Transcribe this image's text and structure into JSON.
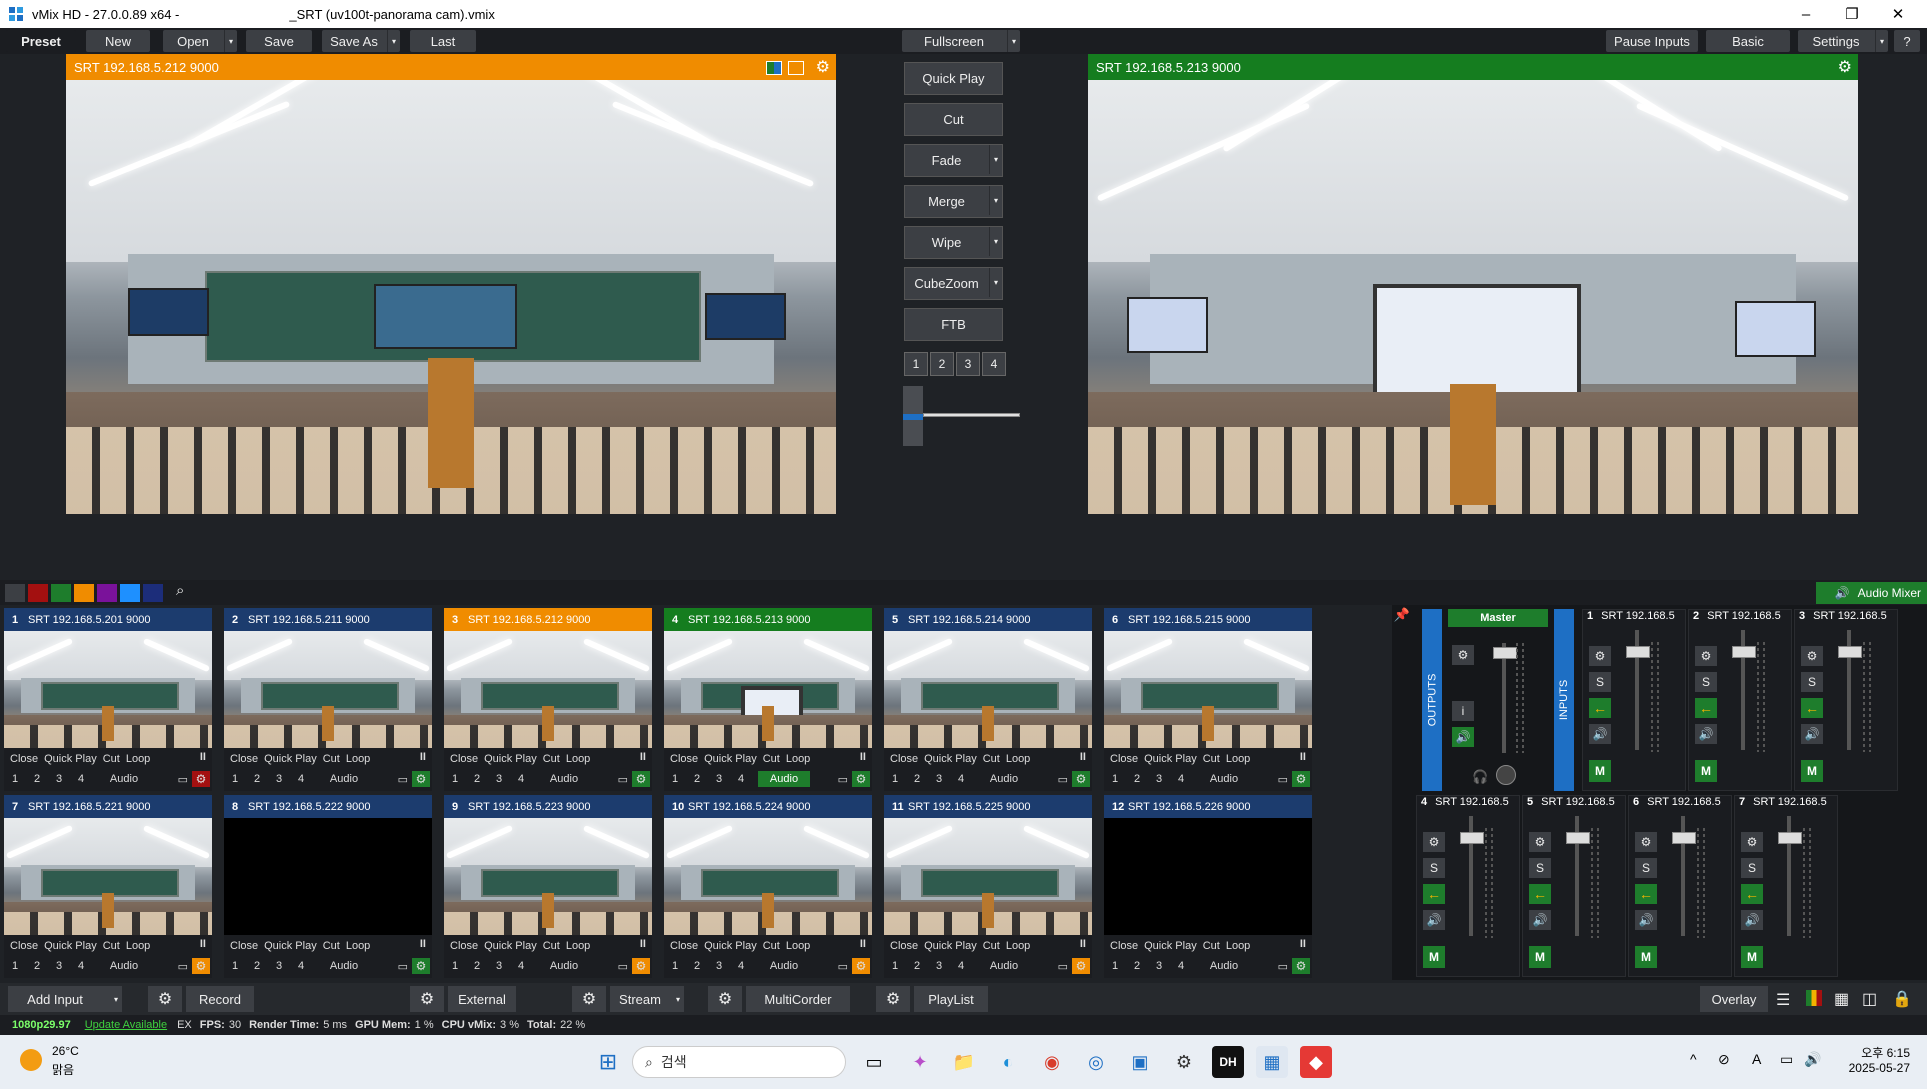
{
  "window": {
    "title": "vMix HD - 27.0.0.89 x64 -",
    "file": "_SRT (uv100t-panorama cam).vmix",
    "minimize": "–",
    "maximize": "❐",
    "close": "✕"
  },
  "menubar": {
    "preset": "Preset",
    "new": "New",
    "open": "Open",
    "save": "Save",
    "save_as": "Save As",
    "last": "Last",
    "fullscreen": "Fullscreen",
    "pause_inputs": "Pause Inputs",
    "basic": "Basic",
    "settings": "Settings",
    "help": "?"
  },
  "preview": {
    "title": "SRT 192.168.5.212 9000",
    "color": "#f08c00"
  },
  "program": {
    "title": "SRT 192.168.5.213 9000",
    "color": "#157d1f"
  },
  "transitions": {
    "quick_play": "Quick Play",
    "cut": "Cut",
    "fade": "Fade",
    "merge": "Merge",
    "wipe": "Wipe",
    "cubezoom": "CubeZoom",
    "ftb": "FTB",
    "numbers": [
      "1",
      "2",
      "3",
      "4"
    ]
  },
  "audio_mixer": {
    "label": "Audio Mixer",
    "outputs": "OUTPUTS",
    "inputs": "INPUTS",
    "master": "Master"
  },
  "inputs": [
    {
      "num": "1",
      "name": "SRT 192.168.5.201 9000",
      "state": "normal"
    },
    {
      "num": "2",
      "name": "SRT 192.168.5.211 9000",
      "state": "normal"
    },
    {
      "num": "3",
      "name": "SRT 192.168.5.212 9000",
      "state": "preview"
    },
    {
      "num": "4",
      "name": "SRT 192.168.5.213 9000",
      "state": "program"
    },
    {
      "num": "5",
      "name": "SRT 192.168.5.214 9000",
      "state": "normal"
    },
    {
      "num": "6",
      "name": "SRT 192.168.5.215 9000",
      "state": "normal"
    },
    {
      "num": "7",
      "name": "SRT 192.168.5.221 9000",
      "state": "normal"
    },
    {
      "num": "8",
      "name": "SRT 192.168.5.222 9000",
      "state": "normal"
    },
    {
      "num": "9",
      "name": "SRT 192.168.5.223 9000",
      "state": "normal"
    },
    {
      "num": "10",
      "name": "SRT 192.168.5.224 9000",
      "state": "normal"
    },
    {
      "num": "11",
      "name": "SRT 192.168.5.225 9000",
      "state": "normal"
    },
    {
      "num": "12",
      "name": "SRT 192.168.5.226 9000",
      "state": "normal"
    }
  ],
  "tile_controls": {
    "close": "Close",
    "quick_play": "Quick Play",
    "cut": "Cut",
    "loop": "Loop",
    "pause": "II",
    "audio": "Audio",
    "nums": [
      "1",
      "2",
      "3",
      "4"
    ]
  },
  "mixer_strips": [
    {
      "num": "1",
      "name": "SRT 192.168.5"
    },
    {
      "num": "2",
      "name": "SRT 192.168.5"
    },
    {
      "num": "3",
      "name": "SRT 192.168.5"
    },
    {
      "num": "4",
      "name": "SRT 192.168.5"
    },
    {
      "num": "5",
      "name": "SRT 192.168.5"
    },
    {
      "num": "6",
      "name": "SRT 192.168.5"
    },
    {
      "num": "7",
      "name": "SRT 192.168.5"
    }
  ],
  "mixer_labels": {
    "s": "S",
    "m": "M",
    "i": "i"
  },
  "bottombar": {
    "add_input": "Add Input",
    "record": "Record",
    "external": "External",
    "stream": "Stream",
    "multicorder": "MultiCorder",
    "playlist": "PlayList",
    "overlay": "Overlay"
  },
  "status": {
    "format": "1080p29.97",
    "update": "Update Available",
    "ex": "EX",
    "fps_label": "FPS:",
    "fps": "30",
    "render_label": "Render Time:",
    "render": "5 ms",
    "gpu_label": "GPU Mem:",
    "gpu": "1 %",
    "cpu_label": "CPU vMix:",
    "cpu": "3 %",
    "total_label": "Total:",
    "total": "22 %"
  },
  "taskbar": {
    "temp": "26°C",
    "weather": "맑음",
    "search": "검색",
    "time": "오후 6:15",
    "date": "2025-05-27",
    "lang": "A"
  }
}
